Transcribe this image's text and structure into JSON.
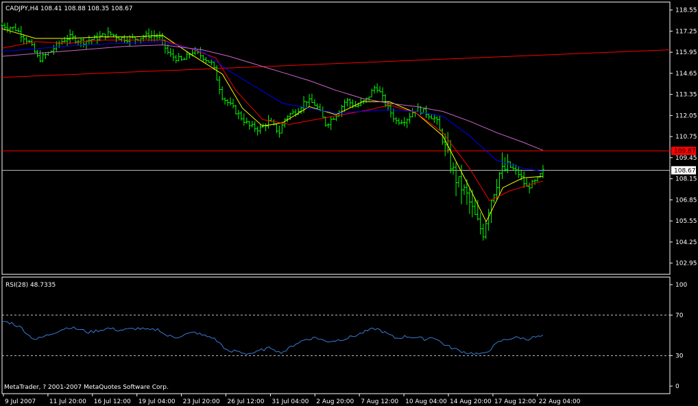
{
  "main_header": "CADJPY,H4  108.41 108.88 108.35 108.67",
  "rsi_header": "RSI(28) 48.7335",
  "copyright": "MetaTrader, ? 2001-2007 MetaQuotes Software Corp.",
  "colors": {
    "background": "#000000",
    "axis": "#ffffff",
    "candle": "#00ff00",
    "ma_fast": "#ffff00",
    "ma_mid": "#ff0000",
    "ma_slow": "#0000ff",
    "ma_slowest": "#cc66cc",
    "trendline": "#ff0000",
    "hline": "#ff0000",
    "bid_line": "#c0c0c0",
    "rsi": "#3a7bd5",
    "rsi_levels": "#c0c0c0"
  },
  "chart_data": [
    {
      "type": "candlestick",
      "symbol": "CADJPY",
      "timeframe": "H4",
      "header_ohlc": {
        "open": 108.41,
        "high": 108.88,
        "low": 108.35,
        "close": 108.67
      },
      "ylim": [
        102.3,
        119.0
      ],
      "y_ticks": [
        "118.55",
        "117.25",
        "115.95",
        "114.65",
        "113.35",
        "112.05",
        "110.75",
        "109.45",
        "108.15",
        "106.85",
        "105.55",
        "104.25",
        "102.95"
      ],
      "x_ticks": [
        "9 Jul 2007",
        "11 Jul 20:00",
        "16 Jul 12:00",
        "19 Jul 04:00",
        "23 Jul 20:00",
        "26 Jul 12:00",
        "31 Jul 04:00",
        "2 Aug 20:00",
        "7 Aug 12:00",
        "10 Aug 04:00",
        "14 Aug 20:00",
        "17 Aug 12:00",
        "22 Aug 04:00"
      ],
      "price_labels": [
        {
          "value": 109.87,
          "text": "109.87",
          "kind": "hline"
        },
        {
          "value": 108.67,
          "text": "108.67",
          "kind": "bid"
        }
      ],
      "trendline": {
        "start": [
          0,
          114.4
        ],
        "end": [
          1,
          116.1
        ]
      },
      "price_path": [
        [
          0,
          117.6
        ],
        [
          0.02,
          117.4
        ],
        [
          0.04,
          116.6
        ],
        [
          0.055,
          115.5
        ],
        [
          0.07,
          115.9
        ],
        [
          0.085,
          116.5
        ],
        [
          0.1,
          116.9
        ],
        [
          0.12,
          116.6
        ],
        [
          0.14,
          116.8
        ],
        [
          0.16,
          117.1
        ],
        [
          0.18,
          116.8
        ],
        [
          0.2,
          116.8
        ],
        [
          0.22,
          117.0
        ],
        [
          0.235,
          116.9
        ],
        [
          0.25,
          115.8
        ],
        [
          0.27,
          115.4
        ],
        [
          0.285,
          116.0
        ],
        [
          0.3,
          115.7
        ],
        [
          0.315,
          115.2
        ],
        [
          0.33,
          113.2
        ],
        [
          0.35,
          112.3
        ],
        [
          0.37,
          111.4
        ],
        [
          0.385,
          111.2
        ],
        [
          0.4,
          111.7
        ],
        [
          0.415,
          111.0
        ],
        [
          0.425,
          112.0
        ],
        [
          0.44,
          112.3
        ],
        [
          0.455,
          113.0
        ],
        [
          0.47,
          112.7
        ],
        [
          0.485,
          111.5
        ],
        [
          0.5,
          112.1
        ],
        [
          0.515,
          113.0
        ],
        [
          0.53,
          112.6
        ],
        [
          0.545,
          113.0
        ],
        [
          0.56,
          113.9
        ],
        [
          0.575,
          112.7
        ],
        [
          0.59,
          111.7
        ],
        [
          0.605,
          111.8
        ],
        [
          0.62,
          112.5
        ],
        [
          0.635,
          112.2
        ],
        [
          0.65,
          111.8
        ],
        [
          0.665,
          109.8
        ],
        [
          0.68,
          108.1
        ],
        [
          0.695,
          107.2
        ],
        [
          0.71,
          105.6
        ],
        [
          0.72,
          104.8
        ],
        [
          0.73,
          106.6
        ],
        [
          0.745,
          108.5
        ],
        [
          0.76,
          108.9
        ],
        [
          0.775,
          108.4
        ],
        [
          0.785,
          107.6
        ],
        [
          0.8,
          108.0
        ],
        [
          0.81,
          108.6
        ]
      ],
      "moving_averages": [
        {
          "path": [
            [
              0,
              117.4
            ],
            [
              0.05,
              116.8
            ],
            [
              0.1,
              116.8
            ],
            [
              0.15,
              116.9
            ],
            [
              0.2,
              116.9
            ],
            [
              0.24,
              117.0
            ],
            [
              0.28,
              115.9
            ],
            [
              0.33,
              114.6
            ],
            [
              0.36,
              112.5
            ],
            [
              0.39,
              111.4
            ],
            [
              0.42,
              111.6
            ],
            [
              0.46,
              112.6
            ],
            [
              0.5,
              112.1
            ],
            [
              0.54,
              112.9
            ],
            [
              0.58,
              112.9
            ],
            [
              0.62,
              112.2
            ],
            [
              0.66,
              110.8
            ],
            [
              0.7,
              107.6
            ],
            [
              0.725,
              105.5
            ],
            [
              0.75,
              107.6
            ],
            [
              0.78,
              108.2
            ],
            [
              0.81,
              108.3
            ]
          ]
        },
        {
          "path": [
            [
              0,
              116.2
            ],
            [
              0.05,
              116.6
            ],
            [
              0.1,
              116.5
            ],
            [
              0.15,
              116.7
            ],
            [
              0.2,
              116.7
            ],
            [
              0.24,
              116.7
            ],
            [
              0.28,
              116.2
            ],
            [
              0.32,
              115.6
            ],
            [
              0.35,
              113.6
            ],
            [
              0.39,
              111.8
            ],
            [
              0.43,
              111.5
            ],
            [
              0.47,
              111.8
            ],
            [
              0.51,
              112.1
            ],
            [
              0.55,
              112.4
            ],
            [
              0.58,
              112.7
            ],
            [
              0.62,
              112.2
            ],
            [
              0.66,
              111.0
            ],
            [
              0.7,
              108.8
            ],
            [
              0.73,
              106.8
            ],
            [
              0.76,
              107.4
            ],
            [
              0.8,
              107.9
            ],
            [
              0.81,
              108.0
            ]
          ]
        },
        {
          "path": [
            [
              0,
              116.0
            ],
            [
              0.06,
              116.2
            ],
            [
              0.12,
              116.4
            ],
            [
              0.18,
              116.5
            ],
            [
              0.24,
              116.6
            ],
            [
              0.3,
              116.0
            ],
            [
              0.34,
              114.8
            ],
            [
              0.38,
              113.8
            ],
            [
              0.42,
              112.8
            ],
            [
              0.46,
              112.5
            ],
            [
              0.5,
              112.2
            ],
            [
              0.54,
              112.3
            ],
            [
              0.58,
              112.4
            ],
            [
              0.62,
              112.3
            ],
            [
              0.66,
              112.0
            ],
            [
              0.7,
              110.8
            ],
            [
              0.74,
              109.3
            ],
            [
              0.78,
              108.8
            ],
            [
              0.81,
              108.6
            ]
          ]
        },
        {
          "path": [
            [
              0,
              115.7
            ],
            [
              0.06,
              115.9
            ],
            [
              0.12,
              116.1
            ],
            [
              0.18,
              116.3
            ],
            [
              0.24,
              116.4
            ],
            [
              0.3,
              116.1
            ],
            [
              0.34,
              115.7
            ],
            [
              0.38,
              115.2
            ],
            [
              0.42,
              114.7
            ],
            [
              0.46,
              114.2
            ],
            [
              0.5,
              113.6
            ],
            [
              0.54,
              113.1
            ],
            [
              0.58,
              112.8
            ],
            [
              0.62,
              112.6
            ],
            [
              0.66,
              112.3
            ],
            [
              0.7,
              111.7
            ],
            [
              0.74,
              111.0
            ],
            [
              0.78,
              110.4
            ],
            [
              0.81,
              109.9
            ]
          ]
        }
      ]
    },
    {
      "type": "line",
      "title": "RSI(28) 48.7335",
      "ylim": [
        0,
        100
      ],
      "y_ticks": [
        "100",
        "70",
        "30",
        "0"
      ],
      "levels": [
        70,
        30
      ],
      "last_value": 48.7335,
      "values_path": [
        [
          0,
          64
        ],
        [
          0.015,
          62
        ],
        [
          0.03,
          57
        ],
        [
          0.04,
          50
        ],
        [
          0.05,
          46
        ],
        [
          0.06,
          48
        ],
        [
          0.075,
          52
        ],
        [
          0.09,
          56
        ],
        [
          0.1,
          58
        ],
        [
          0.115,
          56
        ],
        [
          0.13,
          53
        ],
        [
          0.145,
          55
        ],
        [
          0.16,
          57
        ],
        [
          0.175,
          55
        ],
        [
          0.19,
          56
        ],
        [
          0.205,
          57
        ],
        [
          0.22,
          55
        ],
        [
          0.235,
          56
        ],
        [
          0.245,
          50
        ],
        [
          0.26,
          48
        ],
        [
          0.275,
          51
        ],
        [
          0.29,
          53
        ],
        [
          0.3,
          50
        ],
        [
          0.315,
          48
        ],
        [
          0.33,
          40
        ],
        [
          0.34,
          33
        ],
        [
          0.35,
          35
        ],
        [
          0.365,
          32
        ],
        [
          0.38,
          33
        ],
        [
          0.39,
          36
        ],
        [
          0.405,
          38
        ],
        [
          0.415,
          33
        ],
        [
          0.425,
          35
        ],
        [
          0.44,
          42
        ],
        [
          0.455,
          46
        ],
        [
          0.47,
          48
        ],
        [
          0.485,
          44
        ],
        [
          0.5,
          45
        ],
        [
          0.515,
          47
        ],
        [
          0.53,
          50
        ],
        [
          0.545,
          54
        ],
        [
          0.56,
          57
        ],
        [
          0.575,
          52
        ],
        [
          0.59,
          47
        ],
        [
          0.605,
          49
        ],
        [
          0.62,
          48
        ],
        [
          0.635,
          46
        ],
        [
          0.645,
          49
        ],
        [
          0.655,
          44
        ],
        [
          0.665,
          40
        ],
        [
          0.68,
          36
        ],
        [
          0.695,
          33
        ],
        [
          0.71,
          32
        ],
        [
          0.72,
          31
        ],
        [
          0.73,
          36
        ],
        [
          0.745,
          44
        ],
        [
          0.76,
          47
        ],
        [
          0.775,
          48
        ],
        [
          0.785,
          46
        ],
        [
          0.795,
          48
        ],
        [
          0.81,
          49
        ]
      ]
    }
  ]
}
